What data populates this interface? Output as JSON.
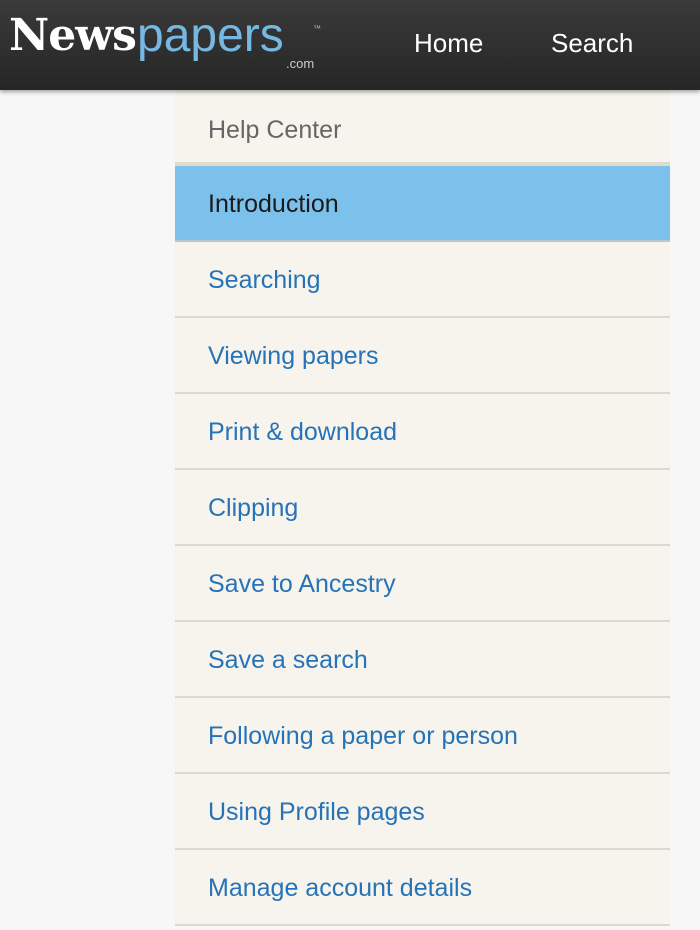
{
  "header": {
    "logo_main": "News",
    "logo_accent": "papers",
    "logo_tm": "™",
    "logo_domain": ".com",
    "nav": [
      {
        "label": "Home"
      },
      {
        "label": "Search"
      }
    ]
  },
  "help_menu": {
    "title": "Help Center",
    "active_index": 0,
    "items": [
      {
        "label": "Introduction"
      },
      {
        "label": "Searching"
      },
      {
        "label": "Viewing papers"
      },
      {
        "label": "Print & download"
      },
      {
        "label": "Clipping"
      },
      {
        "label": "Save to Ancestry"
      },
      {
        "label": "Save a search"
      },
      {
        "label": "Following a paper or person"
      },
      {
        "label": "Using Profile pages"
      },
      {
        "label": "Manage account details"
      }
    ]
  },
  "colors": {
    "header_bg": "#2f2f2f",
    "logo_accent": "#76b8e2",
    "link": "#2673b8",
    "active_bg": "#7cc0ec",
    "menu_bg": "#f6f4ec"
  }
}
